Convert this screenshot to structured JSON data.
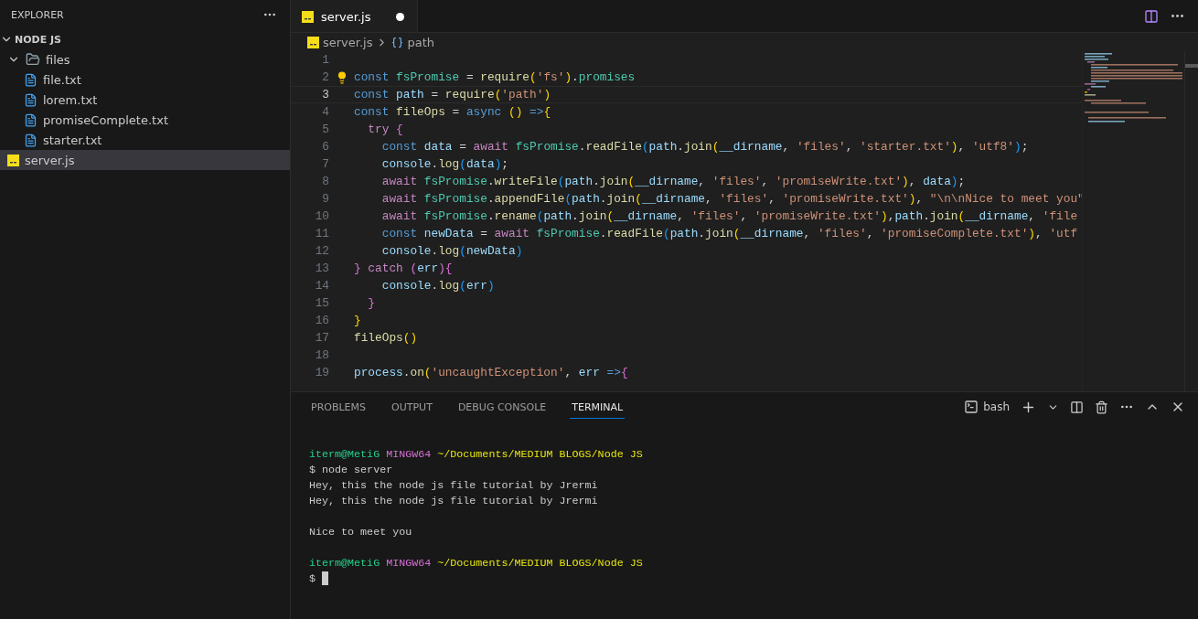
{
  "explorer": {
    "title": "EXPLORER",
    "section": {
      "label": "NODE JS",
      "expanded": true
    },
    "tree": [
      {
        "label": "files",
        "kind": "folder",
        "expanded": true,
        "selected": false,
        "children": [
          {
            "label": "file.txt",
            "kind": "text",
            "selected": false
          },
          {
            "label": "lorem.txt",
            "kind": "text",
            "selected": false
          },
          {
            "label": "promiseComplete.txt",
            "kind": "text",
            "selected": false
          },
          {
            "label": "starter.txt",
            "kind": "text",
            "selected": false
          }
        ]
      },
      {
        "label": "server.js",
        "kind": "js",
        "selected": true
      }
    ]
  },
  "editor_tabs": [
    {
      "label": "server.js",
      "kind": "js",
      "selected": true,
      "modified": true
    }
  ],
  "breadcrumb": [
    {
      "label": "server.js",
      "kind": "js"
    },
    {
      "label": "path",
      "kind": "variable"
    }
  ],
  "code": [
    {
      "number": "1",
      "current": false,
      "lightbulb": false
    },
    {
      "number": "2",
      "current": false,
      "lightbulb": true,
      "tokens": [
        {
          "text": "const",
          "kind": "keyword"
        },
        {
          "text": " fsPromise",
          "kind": "module"
        },
        {
          "text": " = ",
          "kind": "plain"
        },
        {
          "text": "require",
          "kind": "function"
        },
        {
          "text": "(",
          "kind": "b1"
        },
        {
          "text": "'fs'",
          "kind": "string"
        },
        {
          "text": ")",
          "kind": "b1"
        },
        {
          "text": ".",
          "kind": "plain"
        },
        {
          "text": "promises",
          "kind": "module"
        }
      ]
    },
    {
      "number": "3",
      "current": true,
      "lightbulb": false,
      "tokens": [
        {
          "text": "const",
          "kind": "keyword"
        },
        {
          "text": " path",
          "kind": "variable"
        },
        {
          "text": " = ",
          "kind": "plain"
        },
        {
          "text": "require",
          "kind": "function"
        },
        {
          "text": "(",
          "kind": "b1"
        },
        {
          "text": "'path'",
          "kind": "string"
        },
        {
          "text": ")",
          "kind": "b1"
        }
      ]
    },
    {
      "number": "4",
      "current": false,
      "lightbulb": false,
      "tokens": [
        {
          "text": "const",
          "kind": "keyword"
        },
        {
          "text": " fileOps",
          "kind": "function"
        },
        {
          "text": " = ",
          "kind": "plain"
        },
        {
          "text": "async",
          "kind": "keyword"
        },
        {
          "text": " ()",
          "kind": "b1"
        },
        {
          "text": " =>",
          "kind": "keyword"
        },
        {
          "text": "{",
          "kind": "b1"
        }
      ]
    },
    {
      "number": "5",
      "current": false,
      "lightbulb": false,
      "tokens": [
        {
          "text": "  try",
          "kind": "control"
        },
        {
          "text": " {",
          "kind": "b2"
        }
      ]
    },
    {
      "number": "6",
      "current": false,
      "lightbulb": false,
      "tokens": [
        {
          "text": "    const",
          "kind": "keyword"
        },
        {
          "text": " data",
          "kind": "variable"
        },
        {
          "text": " = ",
          "kind": "plain"
        },
        {
          "text": "await",
          "kind": "control"
        },
        {
          "text": " fsPromise",
          "kind": "module"
        },
        {
          "text": ".",
          "kind": "plain"
        },
        {
          "text": "readFile",
          "kind": "function"
        },
        {
          "text": "(",
          "kind": "b3"
        },
        {
          "text": "path",
          "kind": "variable"
        },
        {
          "text": ".",
          "kind": "plain"
        },
        {
          "text": "join",
          "kind": "function"
        },
        {
          "text": "(",
          "kind": "b1"
        },
        {
          "text": "__dirname",
          "kind": "variable"
        },
        {
          "text": ", ",
          "kind": "plain"
        },
        {
          "text": "'files'",
          "kind": "string"
        },
        {
          "text": ", ",
          "kind": "plain"
        },
        {
          "text": "'starter.txt'",
          "kind": "string"
        },
        {
          "text": ")",
          "kind": "b1"
        },
        {
          "text": ", ",
          "kind": "plain"
        },
        {
          "text": "'utf8'",
          "kind": "string"
        },
        {
          "text": ")",
          "kind": "b3"
        },
        {
          "text": ";",
          "kind": "plain"
        }
      ]
    },
    {
      "number": "7",
      "current": false,
      "lightbulb": false,
      "tokens": [
        {
          "text": "    console",
          "kind": "variable"
        },
        {
          "text": ".",
          "kind": "plain"
        },
        {
          "text": "log",
          "kind": "function"
        },
        {
          "text": "(",
          "kind": "b3"
        },
        {
          "text": "data",
          "kind": "variable"
        },
        {
          "text": ")",
          "kind": "b3"
        },
        {
          "text": ";",
          "kind": "plain"
        }
      ]
    },
    {
      "number": "8",
      "current": false,
      "lightbulb": false,
      "tokens": [
        {
          "text": "    await",
          "kind": "control"
        },
        {
          "text": " fsPromise",
          "kind": "module"
        },
        {
          "text": ".",
          "kind": "plain"
        },
        {
          "text": "writeFile",
          "kind": "function"
        },
        {
          "text": "(",
          "kind": "b3"
        },
        {
          "text": "path",
          "kind": "variable"
        },
        {
          "text": ".",
          "kind": "plain"
        },
        {
          "text": "join",
          "kind": "function"
        },
        {
          "text": "(",
          "kind": "b1"
        },
        {
          "text": "__dirname",
          "kind": "variable"
        },
        {
          "text": ", ",
          "kind": "plain"
        },
        {
          "text": "'files'",
          "kind": "string"
        },
        {
          "text": ", ",
          "kind": "plain"
        },
        {
          "text": "'promiseWrite.txt'",
          "kind": "string"
        },
        {
          "text": ")",
          "kind": "b1"
        },
        {
          "text": ", ",
          "kind": "plain"
        },
        {
          "text": "data",
          "kind": "variable"
        },
        {
          "text": ")",
          "kind": "b3"
        },
        {
          "text": ";",
          "kind": "plain"
        }
      ]
    },
    {
      "number": "9",
      "current": false,
      "lightbulb": false,
      "tokens": [
        {
          "text": "    await",
          "kind": "control"
        },
        {
          "text": " fsPromise",
          "kind": "module"
        },
        {
          "text": ".",
          "kind": "plain"
        },
        {
          "text": "appendFile",
          "kind": "function"
        },
        {
          "text": "(",
          "kind": "b3"
        },
        {
          "text": "path",
          "kind": "variable"
        },
        {
          "text": ".",
          "kind": "plain"
        },
        {
          "text": "join",
          "kind": "function"
        },
        {
          "text": "(",
          "kind": "b1"
        },
        {
          "text": "__dirname",
          "kind": "variable"
        },
        {
          "text": ", ",
          "kind": "plain"
        },
        {
          "text": "'files'",
          "kind": "string"
        },
        {
          "text": ", ",
          "kind": "plain"
        },
        {
          "text": "'promiseWrite.txt'",
          "kind": "string"
        },
        {
          "text": ")",
          "kind": "b1"
        },
        {
          "text": ", ",
          "kind": "plain"
        },
        {
          "text": "\"\\n\\nNice to meet you\"",
          "kind": "string"
        }
      ]
    },
    {
      "number": "10",
      "current": false,
      "lightbulb": false,
      "tokens": [
        {
          "text": "    await",
          "kind": "control"
        },
        {
          "text": " fsPromise",
          "kind": "module"
        },
        {
          "text": ".",
          "kind": "plain"
        },
        {
          "text": "rename",
          "kind": "function"
        },
        {
          "text": "(",
          "kind": "b3"
        },
        {
          "text": "path",
          "kind": "variable"
        },
        {
          "text": ".",
          "kind": "plain"
        },
        {
          "text": "join",
          "kind": "function"
        },
        {
          "text": "(",
          "kind": "b1"
        },
        {
          "text": "__dirname",
          "kind": "variable"
        },
        {
          "text": ", ",
          "kind": "plain"
        },
        {
          "text": "'files'",
          "kind": "string"
        },
        {
          "text": ", ",
          "kind": "plain"
        },
        {
          "text": "'promiseWrite.txt'",
          "kind": "string"
        },
        {
          "text": ")",
          "kind": "b1"
        },
        {
          "text": ",",
          "kind": "plain"
        },
        {
          "text": "path",
          "kind": "variable"
        },
        {
          "text": ".",
          "kind": "plain"
        },
        {
          "text": "join",
          "kind": "function"
        },
        {
          "text": "(",
          "kind": "b1"
        },
        {
          "text": "__dirname",
          "kind": "variable"
        },
        {
          "text": ", ",
          "kind": "plain"
        },
        {
          "text": "'file",
          "kind": "string"
        }
      ]
    },
    {
      "number": "11",
      "current": false,
      "lightbulb": false,
      "tokens": [
        {
          "text": "    const",
          "kind": "keyword"
        },
        {
          "text": " newData",
          "kind": "variable"
        },
        {
          "text": " = ",
          "kind": "plain"
        },
        {
          "text": "await",
          "kind": "control"
        },
        {
          "text": " fsPromise",
          "kind": "module"
        },
        {
          "text": ".",
          "kind": "plain"
        },
        {
          "text": "readFile",
          "kind": "function"
        },
        {
          "text": "(",
          "kind": "b3"
        },
        {
          "text": "path",
          "kind": "variable"
        },
        {
          "text": ".",
          "kind": "plain"
        },
        {
          "text": "join",
          "kind": "function"
        },
        {
          "text": "(",
          "kind": "b1"
        },
        {
          "text": "__dirname",
          "kind": "variable"
        },
        {
          "text": ", ",
          "kind": "plain"
        },
        {
          "text": "'files'",
          "kind": "string"
        },
        {
          "text": ", ",
          "kind": "plain"
        },
        {
          "text": "'promiseComplete.txt'",
          "kind": "string"
        },
        {
          "text": ")",
          "kind": "b1"
        },
        {
          "text": ", ",
          "kind": "plain"
        },
        {
          "text": "'utf",
          "kind": "string"
        }
      ]
    },
    {
      "number": "12",
      "current": false,
      "lightbulb": false,
      "tokens": [
        {
          "text": "    console",
          "kind": "variable"
        },
        {
          "text": ".",
          "kind": "plain"
        },
        {
          "text": "log",
          "kind": "function"
        },
        {
          "text": "(",
          "kind": "b3"
        },
        {
          "text": "newData",
          "kind": "variable"
        },
        {
          "text": ")",
          "kind": "b3"
        }
      ]
    },
    {
      "number": "13",
      "current": false,
      "lightbulb": false,
      "tokens": [
        {
          "text": "}",
          "kind": "b2"
        },
        {
          "text": " catch",
          "kind": "control"
        },
        {
          "text": " (",
          "kind": "b2"
        },
        {
          "text": "err",
          "kind": "variable"
        },
        {
          "text": ")",
          "kind": "b2"
        },
        {
          "text": "{",
          "kind": "b2"
        }
      ]
    },
    {
      "number": "14",
      "current": false,
      "lightbulb": false,
      "tokens": [
        {
          "text": "    console",
          "kind": "variable"
        },
        {
          "text": ".",
          "kind": "plain"
        },
        {
          "text": "log",
          "kind": "function"
        },
        {
          "text": "(",
          "kind": "b3"
        },
        {
          "text": "err",
          "kind": "variable"
        },
        {
          "text": ")",
          "kind": "b3"
        }
      ]
    },
    {
      "number": "15",
      "current": false,
      "lightbulb": false,
      "tokens": [
        {
          "text": "  }",
          "kind": "b2"
        }
      ]
    },
    {
      "number": "16",
      "current": false,
      "lightbulb": false,
      "tokens": [
        {
          "text": "}",
          "kind": "b1"
        }
      ]
    },
    {
      "number": "17",
      "current": false,
      "lightbulb": false,
      "tokens": [
        {
          "text": "fileOps",
          "kind": "function"
        },
        {
          "text": "()",
          "kind": "b1"
        }
      ]
    },
    {
      "number": "18",
      "current": false,
      "lightbulb": false
    },
    {
      "number": "19",
      "current": false,
      "lightbulb": false,
      "tokens": [
        {
          "text": "process",
          "kind": "variable"
        },
        {
          "text": ".",
          "kind": "plain"
        },
        {
          "text": "on",
          "kind": "function"
        },
        {
          "text": "(",
          "kind": "b1"
        },
        {
          "text": "'uncaughtException'",
          "kind": "string"
        },
        {
          "text": ", ",
          "kind": "plain"
        },
        {
          "text": "err",
          "kind": "variable"
        },
        {
          "text": " =>",
          "kind": "keyword"
        },
        {
          "text": "{",
          "kind": "b2"
        }
      ]
    }
  ],
  "panel": {
    "tabs": [
      {
        "label": "PROBLEMS",
        "selected": false
      },
      {
        "label": "OUTPUT",
        "selected": false
      },
      {
        "label": "DEBUG CONSOLE",
        "selected": false
      },
      {
        "label": "TERMINAL",
        "selected": true
      }
    ],
    "shell": "bash",
    "terminal": [
      {
        "kind": "prompt",
        "segments": [
          {
            "text": "iterm@MetiG",
            "kind": "user"
          },
          {
            "text": " MINGW64",
            "kind": "system"
          },
          {
            "text": " ~/Documents/MEDIUM BLOGS/Node JS",
            "kind": "path"
          }
        ]
      },
      {
        "kind": "text",
        "segments": [
          {
            "text": "$ node server",
            "kind": "plain"
          }
        ]
      },
      {
        "kind": "text",
        "segments": [
          {
            "text": "Hey, this the node js file tutorial by Jrermi",
            "kind": "plain"
          }
        ]
      },
      {
        "kind": "text",
        "segments": [
          {
            "text": "Hey, this the node js file tutorial by Jrermi",
            "kind": "plain"
          }
        ]
      },
      {
        "kind": "blank"
      },
      {
        "kind": "text",
        "segments": [
          {
            "text": "Nice to meet you",
            "kind": "plain"
          }
        ]
      },
      {
        "kind": "blank"
      },
      {
        "kind": "prompt",
        "segments": [
          {
            "text": "iterm@MetiG",
            "kind": "user"
          },
          {
            "text": " MINGW64",
            "kind": "system"
          },
          {
            "text": " ~/Documents/MEDIUM BLOGS/Node JS",
            "kind": "path"
          }
        ]
      },
      {
        "kind": "input",
        "segments": [
          {
            "text": "$",
            "kind": "plain"
          }
        ]
      }
    ]
  }
}
